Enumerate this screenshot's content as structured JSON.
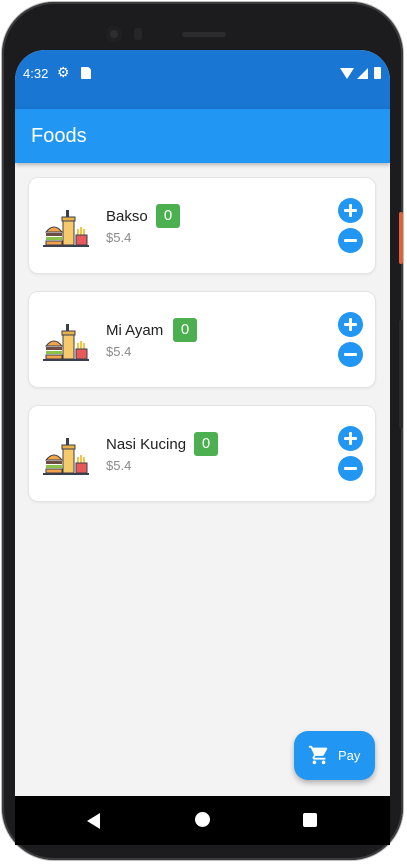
{
  "status_bar": {
    "time": "4:32",
    "icons": [
      "gear-icon",
      "sd-card-icon",
      "wifi-icon",
      "signal-icon",
      "battery-icon"
    ]
  },
  "app_bar": {
    "title": "Foods"
  },
  "foods": [
    {
      "name": "Bakso",
      "price": "$5.4",
      "quantity": "0"
    },
    {
      "name": "Mi Ayam",
      "price": "$5.4",
      "quantity": "0"
    },
    {
      "name": "Nasi Kucing",
      "price": "$5.4",
      "quantity": "0"
    }
  ],
  "pay_button": {
    "label": "Pay",
    "icon": "cart-icon"
  },
  "nav_bar": {
    "icons": [
      "back-icon",
      "home-icon",
      "recents-icon"
    ]
  },
  "colors": {
    "primary": "#2196f3",
    "status_bar": "#1976d2",
    "badge": "#4caf50",
    "background": "#f3f3f3"
  }
}
